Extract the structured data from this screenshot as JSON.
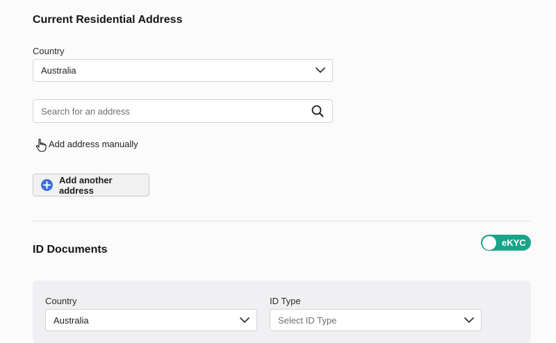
{
  "address_section": {
    "title": "Current Residential Address",
    "country_label": "Country",
    "country_value": "Australia",
    "search_placeholder": "Search for an address",
    "manual_link": "Add address manually",
    "add_another_label": "Add another address"
  },
  "id_section": {
    "title": "ID Documents",
    "ekyc_toggle_label": "eKYC",
    "ekyc_enabled": true,
    "country_label": "Country",
    "country_value": "Australia",
    "id_type_label": "ID Type",
    "id_type_placeholder": "Select ID Type"
  },
  "colors": {
    "accent_toggle": "#18a589",
    "add_icon": "#3b6fe0"
  },
  "icons": [
    "chevron-down-icon",
    "search-icon",
    "pointer-cursor-icon",
    "plus-circle-icon"
  ]
}
